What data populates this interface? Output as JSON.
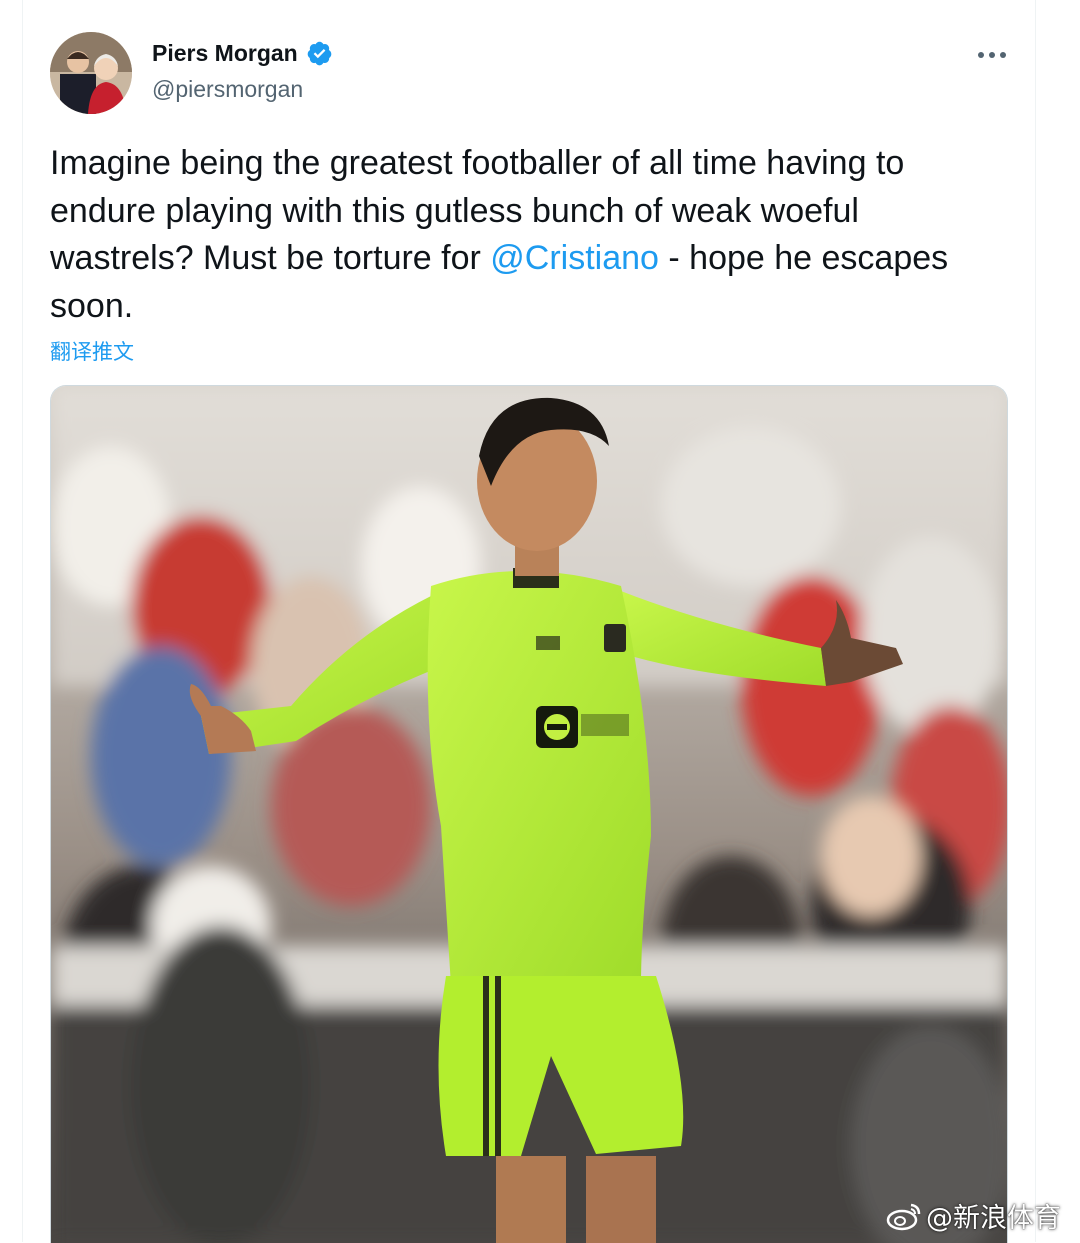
{
  "tweet": {
    "author_name": "Piers Morgan",
    "author_handle": "@piersmorgan",
    "text_before": "Imagine being the greatest footballer of all time having to endure playing with this gutless bunch of weak woeful wastrels? Must be torture for ",
    "mention": "@Cristiano",
    "text_after": " - hope he escapes soon.",
    "translate_label": "翻译推文"
  },
  "icons": {
    "verified": "verified-badge-icon",
    "more": "more-horizontal-icon"
  },
  "colors": {
    "link": "#1d9bf0",
    "text": "#0f1419",
    "secondary": "#536471",
    "kit_green": "#b7f23a"
  },
  "watermark": {
    "text": "@新浪体育"
  }
}
